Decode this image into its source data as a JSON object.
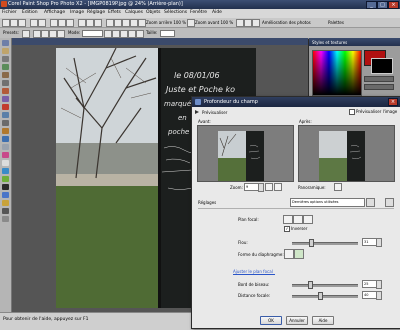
{
  "app": {
    "title": "Corel Paint Shop Pro Photo X2 - [IMGP0819P.jpg @ 24% (Arrière-plan)]",
    "window_controls": {
      "minimize": "_",
      "maximize": "□",
      "close": "×"
    }
  },
  "menubar": [
    "Fichier",
    "Édition",
    "Affichage",
    "Image",
    "Réglage",
    "Effets",
    "Calques",
    "Objets",
    "Sélections",
    "Fenêtre",
    "Aide"
  ],
  "toolbar1": {
    "zoom_out_label": "Zoom arrière 100 %",
    "zoom_in_label": "Zoom avant 100 %",
    "enhance_label": "Amélioration des photos",
    "palettes_label": "Palettes"
  },
  "toolbar2": {
    "presets_label": "Presets:",
    "mode_label": "Mode:",
    "size_label": "Taille:"
  },
  "palette": {
    "title": "Styles et textures"
  },
  "status": {
    "text": "Pour obtenir de l'aide, appuyez sur F1"
  },
  "photo": {
    "handwriting": [
      "le 08/01/06",
      "Juste et Poche ko",
      "marquées",
      "en",
      "poche"
    ]
  },
  "dialog": {
    "title": "Profondeur du champ",
    "preview_label": "Prévisualiser",
    "preview_image_label": "Prévisualiser l'image",
    "before_label": "Avant:",
    "after_label": "Après:",
    "zoom_label": "Zoom:",
    "zoom_value": "9",
    "pan_label": "Panoramique:",
    "settings_label": "Réglages",
    "settings_value": "Dernières options utilisées",
    "focal_plane_label": "Plan focal:",
    "invert_label": "Inverser",
    "invert_checked": true,
    "blur_label": "Flou:",
    "blur_value": "31",
    "aperture_label": "Forme du diaphragme:",
    "adjust_focal_label": "Ajuster le plan focal",
    "edge_blur_label": "Bord de biseau:",
    "edge_blur_value": "25",
    "focal_distance_label": "Distance focale:",
    "focal_distance_value": "40",
    "ok_label": "OK",
    "cancel_label": "Annuler",
    "help_label": "Aide"
  },
  "colors": {
    "title_bar": "#2a3a5e",
    "dialog_bg": "#e9e9e9",
    "link": "#2a55c8",
    "palette_red": "#b01010"
  }
}
